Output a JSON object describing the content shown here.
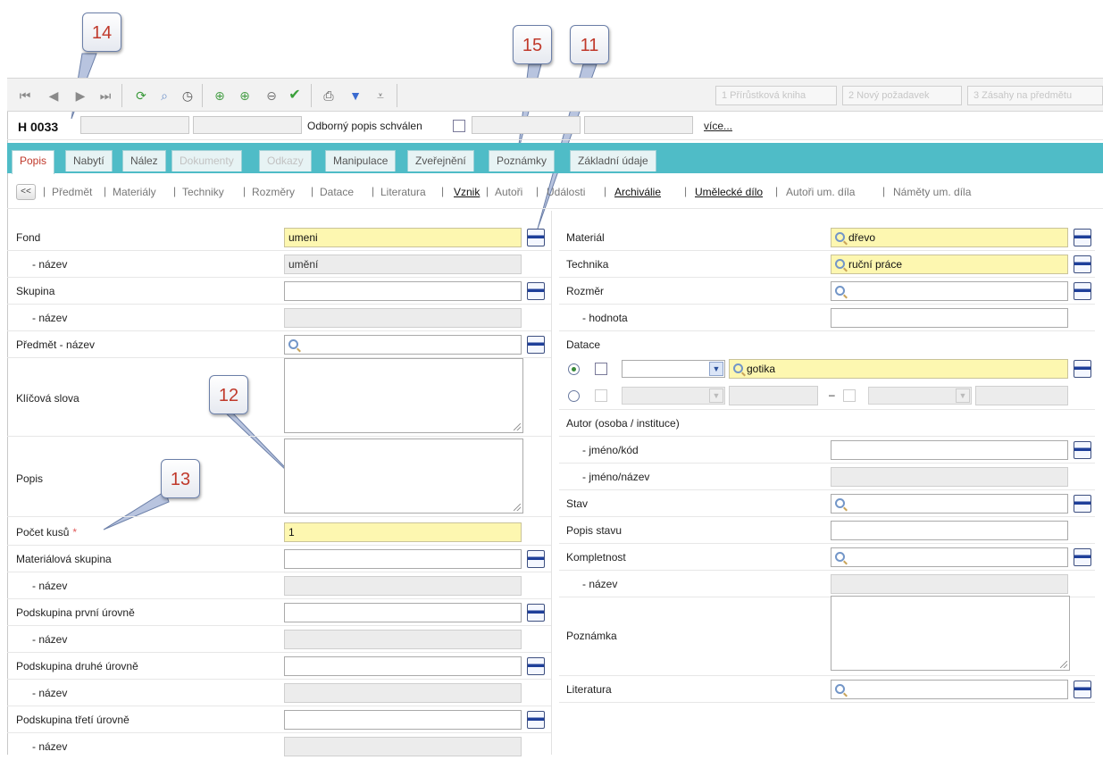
{
  "callouts": [
    "14",
    "15",
    "11",
    "12",
    "13"
  ],
  "toolbar": {
    "icons": [
      "first-record-icon",
      "previous-record-icon",
      "next-record-icon",
      "last-record-icon",
      "refresh-icon",
      "search-icon",
      "history-icon",
      "add-icon",
      "add-copy-icon",
      "remove-icon",
      "confirm-icon",
      "print-icon",
      "filter-icon",
      "filter-advanced-icon"
    ],
    "buttons": [
      "1 Přírůstková kniha",
      "2 Nový požadavek",
      "3 Zásahy na předmětu"
    ]
  },
  "record": {
    "id": "H 0033",
    "approved_label": "Odborný popis schválen",
    "more_link": "více..."
  },
  "tabs": [
    {
      "label": "Popis",
      "state": "active"
    },
    {
      "label": "Nabytí",
      "state": "normal"
    },
    {
      "label": "Nález",
      "state": "normal"
    },
    {
      "label": "Dokumenty",
      "state": "disabled"
    },
    {
      "label": "Odkazy",
      "state": "disabled"
    },
    {
      "label": "Manipulace",
      "state": "normal"
    },
    {
      "label": "Zveřejnění",
      "state": "normal"
    },
    {
      "label": "Poznámky",
      "state": "normal"
    },
    {
      "label": "Základní údaje",
      "state": "normal"
    }
  ],
  "subnav": {
    "back": "<<",
    "links": [
      "Předmět",
      "Materiály",
      "Techniky",
      "Rozměry",
      "Datace",
      "Literatura",
      "Vznik",
      "Autoři",
      "Události",
      "Archiválie",
      "Umělecké dílo",
      "Autoři um. díla",
      "Náměty um. díla"
    ]
  },
  "left_form": {
    "fond_label": "Fond",
    "fond_value": "umeni",
    "fond_name_label": "- název",
    "fond_name_value": "umění",
    "skupina_label": "Skupina",
    "skupina_name_label": "- název",
    "predmet_label": "Předmět - název",
    "keywords_label": "Klíčová slova",
    "popis_label": "Popis",
    "pocet_label": "Počet kusů",
    "pocet_required": "*",
    "pocet_value": "1",
    "matskup_label": "Materiálová skupina",
    "matskup_name_label": "- název",
    "podsk1_label": "Podskupina první úrovně",
    "podsk1_name_label": "- název",
    "podsk2_label": "Podskupina druhé úrovně",
    "podsk2_name_label": "- název",
    "podsk3_label": "Podskupina třetí úrovně",
    "podsk3_name_label": "- název"
  },
  "right_form": {
    "material_label": "Materiál",
    "material_value": "dřevo",
    "technika_label": "Technika",
    "technika_value": "ruční práce",
    "rozmer_label": "Rozměr",
    "hodnota_label": "- hodnota",
    "datace_label": "Datace",
    "datace_value": "gotika",
    "range_dash": "–",
    "autor_label": "Autor (osoba / instituce)",
    "jmeno_kod_label": "- jméno/kód",
    "jmeno_nazev_label": "- jméno/název",
    "stav_label": "Stav",
    "popis_stavu_label": "Popis stavu",
    "kompletnost_label": "Kompletnost",
    "kompletnost_name_label": "- název",
    "poznamka_label": "Poznámka",
    "literatura_label": "Literatura"
  },
  "colors": {
    "tab_strip": "#4fbcc7",
    "highlight_field": "#fdf7b0",
    "readonly_field": "#ececec",
    "callout_number": "#c0392b"
  }
}
